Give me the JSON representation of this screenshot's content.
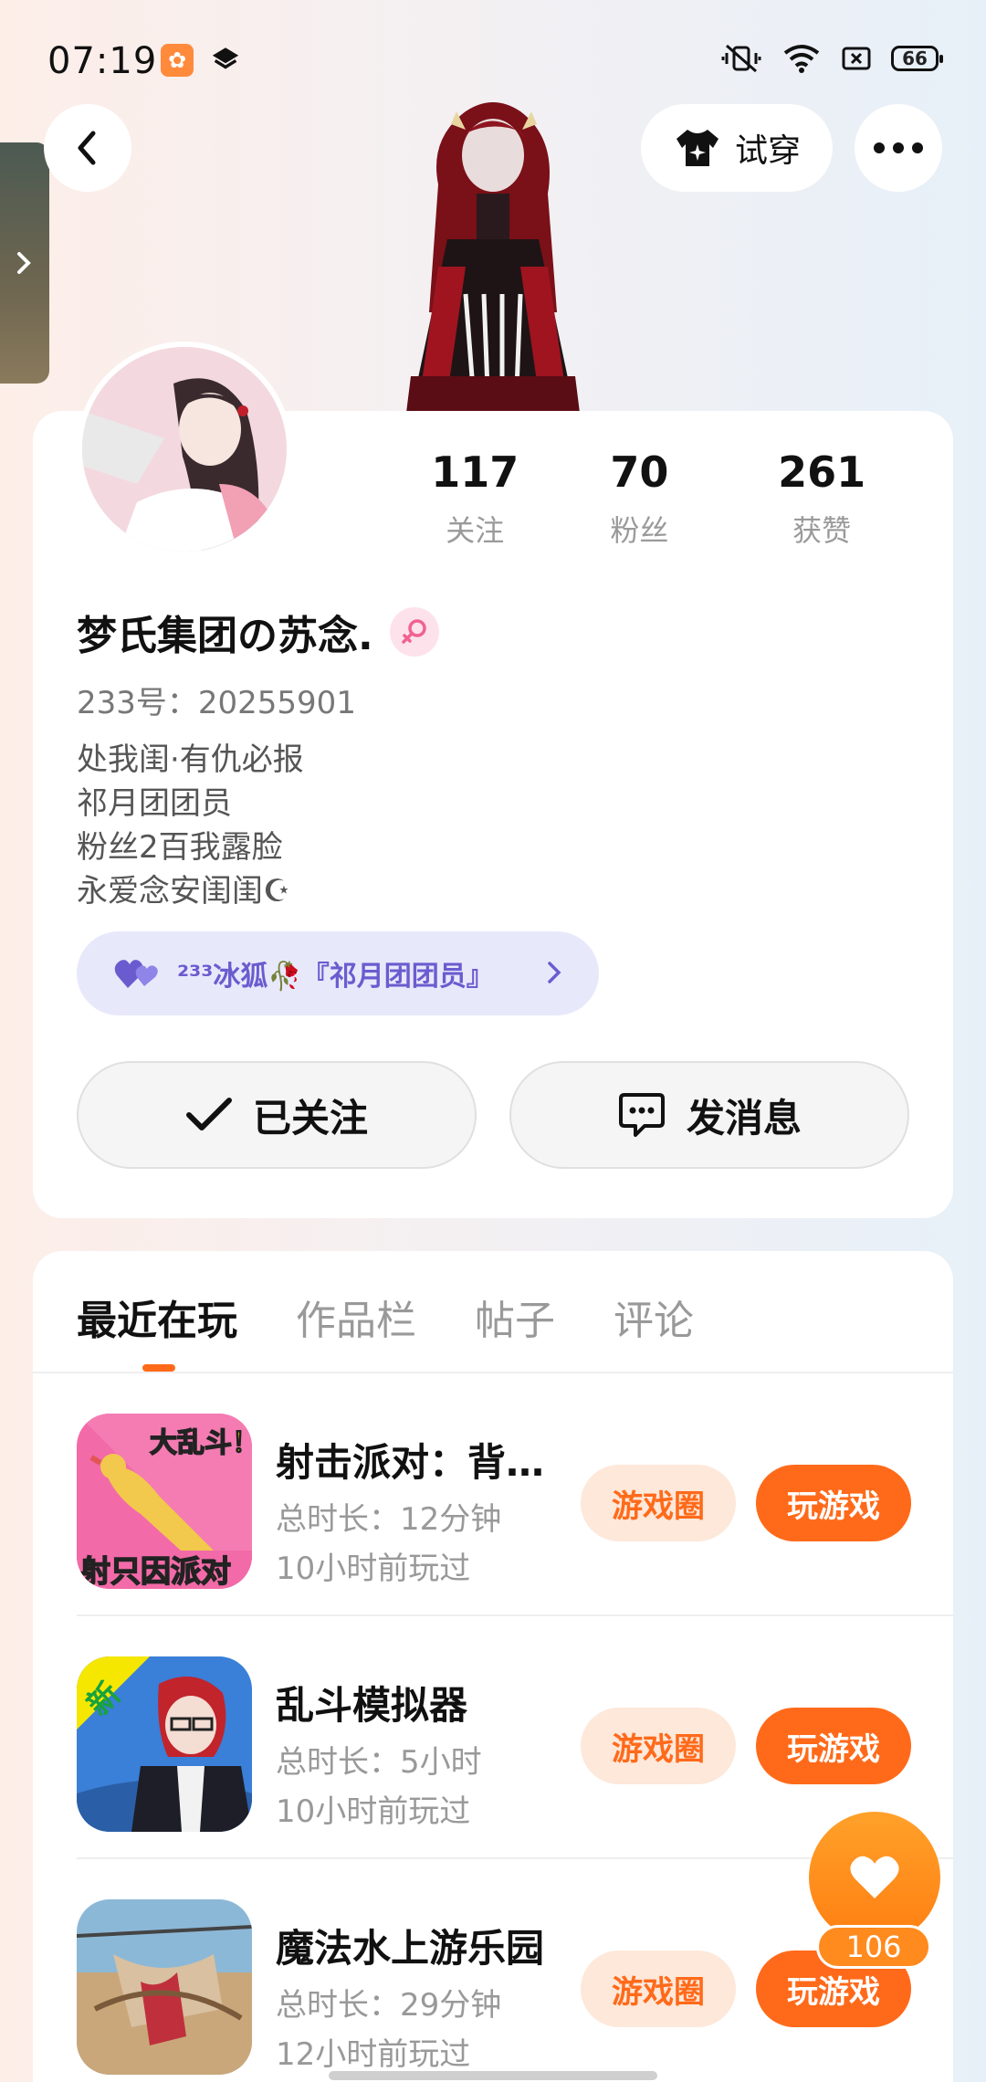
{
  "status_bar": {
    "time": "07:19",
    "battery": "66"
  },
  "header": {
    "tryon_label": "试穿"
  },
  "profile": {
    "stats": [
      {
        "value": "117",
        "label": "关注"
      },
      {
        "value": "70",
        "label": "粉丝"
      },
      {
        "value": "261",
        "label": "获赞"
      }
    ],
    "username": "梦氏集团の苏念.",
    "uid": "233号：20255901",
    "bio": [
      "处我闺·有仇必报",
      "祁月团团员",
      "粉丝2百我露脸",
      "永爱念安闺闺☪"
    ],
    "fanclub": "²³³冰狐🥀『祁月团团员』",
    "follow_label": "已关注",
    "message_label": "发消息"
  },
  "tabs": [
    "最近在玩",
    "作品栏",
    "帖子",
    "评论"
  ],
  "games": [
    {
      "title": "射击派对：背…",
      "duration": "总时长：12分钟",
      "last_played": "10小时前玩过",
      "circle_label": "游戏圈",
      "play_label": "玩游戏",
      "icon_text_top": "大乱斗！",
      "icon_text_bottom": "射只因派对"
    },
    {
      "title": "乱斗模拟器",
      "duration": "总时长：5小时",
      "last_played": "10小时前玩过",
      "circle_label": "游戏圈",
      "play_label": "玩游戏",
      "icon_text_top": "新"
    },
    {
      "title": "魔法水上游乐园",
      "duration": "总时长：29分钟",
      "last_played": "12小时前玩过",
      "circle_label": "游戏圈",
      "play_label": "玩游戏"
    }
  ],
  "fab": {
    "count": "106"
  },
  "colors": {
    "accent": "#ff6a1a",
    "accent_light": "#fde8da",
    "fanclub_bg": "#e8e8fb",
    "fanclub_text": "#6a5ccf"
  }
}
